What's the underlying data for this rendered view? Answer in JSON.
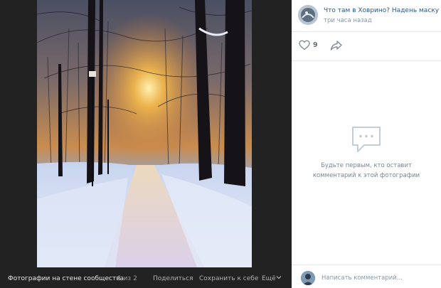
{
  "viewer": {
    "album_label": "Фотографии на стене сообщества",
    "counter": "1 из 2",
    "share_label": "Поделиться",
    "save_label": "Сохранить к себе",
    "more_label": "Ещё"
  },
  "post": {
    "author": "Что там в Ховрино? Надень маску",
    "time": "три часа назад",
    "likes": "9"
  },
  "comments": {
    "empty_line1": "Будьте первым, кто оставит",
    "empty_line2": "комментарий к этой фотографии",
    "placeholder": "Написать комментарий..."
  },
  "colors": {
    "viewer_bg": "#222222",
    "link": "#2a5885",
    "muted": "#8a97a6"
  },
  "icons": {
    "like": "heart-icon",
    "share": "share-arrow-icon",
    "empty": "comment-bubble-icon",
    "more": "chevron-down-icon"
  }
}
